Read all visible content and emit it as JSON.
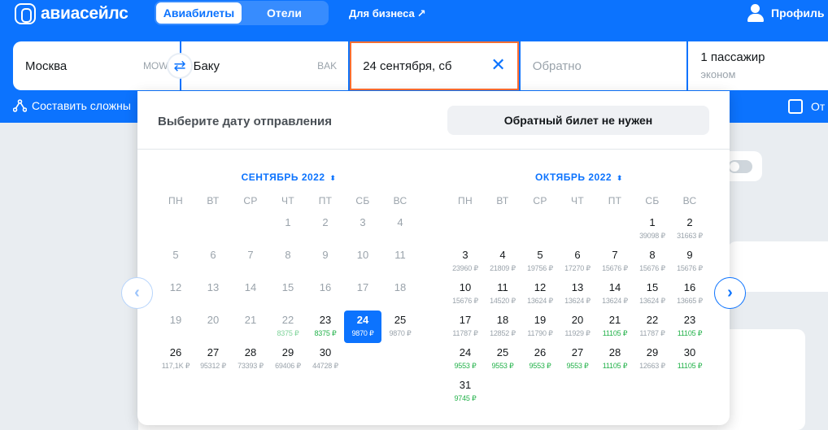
{
  "header": {
    "logo_text": "авиасейлс",
    "tabs": [
      {
        "label": "Авиабилеты",
        "active": true
      },
      {
        "label": "Отели",
        "active": false
      }
    ],
    "business_link": "Для бизнеса",
    "business_arrow": "↗",
    "profile_label": "Профиль"
  },
  "search": {
    "origin": {
      "city": "Москва",
      "iata": "MOW"
    },
    "swap_icon": "⇄",
    "destination": {
      "city": "Баку",
      "iata": "BAK"
    },
    "depart_date": "24 сентября, сб",
    "clear_icon": "✕",
    "return_placeholder": "Обратно",
    "passengers": "1 пассажир",
    "cabin": "эконом"
  },
  "subbar": {
    "complex_route": "Составить сложны",
    "checkbox_label": "От"
  },
  "calendar": {
    "title": "Выберите дату отправления",
    "no_return_button": "Обратный билет не нужен",
    "weekdays": [
      "ПН",
      "ВТ",
      "СР",
      "ЧТ",
      "ПТ",
      "СБ",
      "ВС"
    ],
    "nav_prev_icon": "‹",
    "nav_next_icon": "›",
    "months": [
      {
        "title": "СЕНТЯБРЬ 2022",
        "chevron": "⌃⌄",
        "offset": 3,
        "days": [
          {
            "d": "1",
            "p": "",
            "s": "past"
          },
          {
            "d": "2",
            "p": "",
            "s": "past"
          },
          {
            "d": "3",
            "p": "",
            "s": "past"
          },
          {
            "d": "4",
            "p": "",
            "s": "past"
          },
          {
            "d": "5",
            "p": "",
            "s": "past"
          },
          {
            "d": "6",
            "p": "",
            "s": "past"
          },
          {
            "d": "7",
            "p": "",
            "s": "past"
          },
          {
            "d": "8",
            "p": "",
            "s": "past"
          },
          {
            "d": "9",
            "p": "",
            "s": "past"
          },
          {
            "d": "10",
            "p": "",
            "s": "past"
          },
          {
            "d": "11",
            "p": "",
            "s": "past"
          },
          {
            "d": "12",
            "p": "",
            "s": "past"
          },
          {
            "d": "13",
            "p": "",
            "s": "past"
          },
          {
            "d": "14",
            "p": "",
            "s": "past"
          },
          {
            "d": "15",
            "p": "",
            "s": "past"
          },
          {
            "d": "16",
            "p": "",
            "s": "past"
          },
          {
            "d": "17",
            "p": "",
            "s": "past"
          },
          {
            "d": "18",
            "p": "",
            "s": "past"
          },
          {
            "d": "19",
            "p": "",
            "s": "past"
          },
          {
            "d": "20",
            "p": "",
            "s": "past"
          },
          {
            "d": "21",
            "p": "",
            "s": "past"
          },
          {
            "d": "22",
            "p": "8375 ₽",
            "s": "past-fade"
          },
          {
            "d": "23",
            "p": "8375 ₽",
            "s": "cheap"
          },
          {
            "d": "24",
            "p": "9870 ₽",
            "s": "selected"
          },
          {
            "d": "25",
            "p": "9870 ₽",
            "s": ""
          },
          {
            "d": "26",
            "p": "117,1K ₽",
            "s": ""
          },
          {
            "d": "27",
            "p": "95312 ₽",
            "s": ""
          },
          {
            "d": "28",
            "p": "73393 ₽",
            "s": ""
          },
          {
            "d": "29",
            "p": "69406 ₽",
            "s": ""
          },
          {
            "d": "30",
            "p": "44728 ₽",
            "s": ""
          }
        ]
      },
      {
        "title": "ОКТЯБРЬ 2022",
        "chevron": "⌃⌄",
        "offset": 5,
        "days": [
          {
            "d": "1",
            "p": "39098 ₽",
            "s": ""
          },
          {
            "d": "2",
            "p": "31663 ₽",
            "s": ""
          },
          {
            "d": "3",
            "p": "23960 ₽",
            "s": ""
          },
          {
            "d": "4",
            "p": "21809 ₽",
            "s": ""
          },
          {
            "d": "5",
            "p": "19756 ₽",
            "s": ""
          },
          {
            "d": "6",
            "p": "17270 ₽",
            "s": ""
          },
          {
            "d": "7",
            "p": "15676 ₽",
            "s": ""
          },
          {
            "d": "8",
            "p": "15676 ₽",
            "s": ""
          },
          {
            "d": "9",
            "p": "15676 ₽",
            "s": ""
          },
          {
            "d": "10",
            "p": "15676 ₽",
            "s": ""
          },
          {
            "d": "11",
            "p": "14520 ₽",
            "s": ""
          },
          {
            "d": "12",
            "p": "13624 ₽",
            "s": ""
          },
          {
            "d": "13",
            "p": "13624 ₽",
            "s": ""
          },
          {
            "d": "14",
            "p": "13624 ₽",
            "s": ""
          },
          {
            "d": "15",
            "p": "13624 ₽",
            "s": ""
          },
          {
            "d": "16",
            "p": "13665 ₽",
            "s": ""
          },
          {
            "d": "17",
            "p": "11787 ₽",
            "s": ""
          },
          {
            "d": "18",
            "p": "12852 ₽",
            "s": ""
          },
          {
            "d": "19",
            "p": "11790 ₽",
            "s": ""
          },
          {
            "d": "20",
            "p": "11929 ₽",
            "s": ""
          },
          {
            "d": "21",
            "p": "11105 ₽",
            "s": "cheap"
          },
          {
            "d": "22",
            "p": "11787 ₽",
            "s": ""
          },
          {
            "d": "23",
            "p": "11105 ₽",
            "s": "cheap"
          },
          {
            "d": "24",
            "p": "9553 ₽",
            "s": "cheap"
          },
          {
            "d": "25",
            "p": "9553 ₽",
            "s": "cheap"
          },
          {
            "d": "26",
            "p": "9553 ₽",
            "s": "cheap"
          },
          {
            "d": "27",
            "p": "9553 ₽",
            "s": "cheap"
          },
          {
            "d": "28",
            "p": "11105 ₽",
            "s": "cheap"
          },
          {
            "d": "29",
            "p": "12663 ₽",
            "s": ""
          },
          {
            "d": "30",
            "p": "11105 ₽",
            "s": "cheap"
          },
          {
            "d": "31",
            "p": "9745 ₽",
            "s": "cheap"
          }
        ]
      }
    ]
  }
}
